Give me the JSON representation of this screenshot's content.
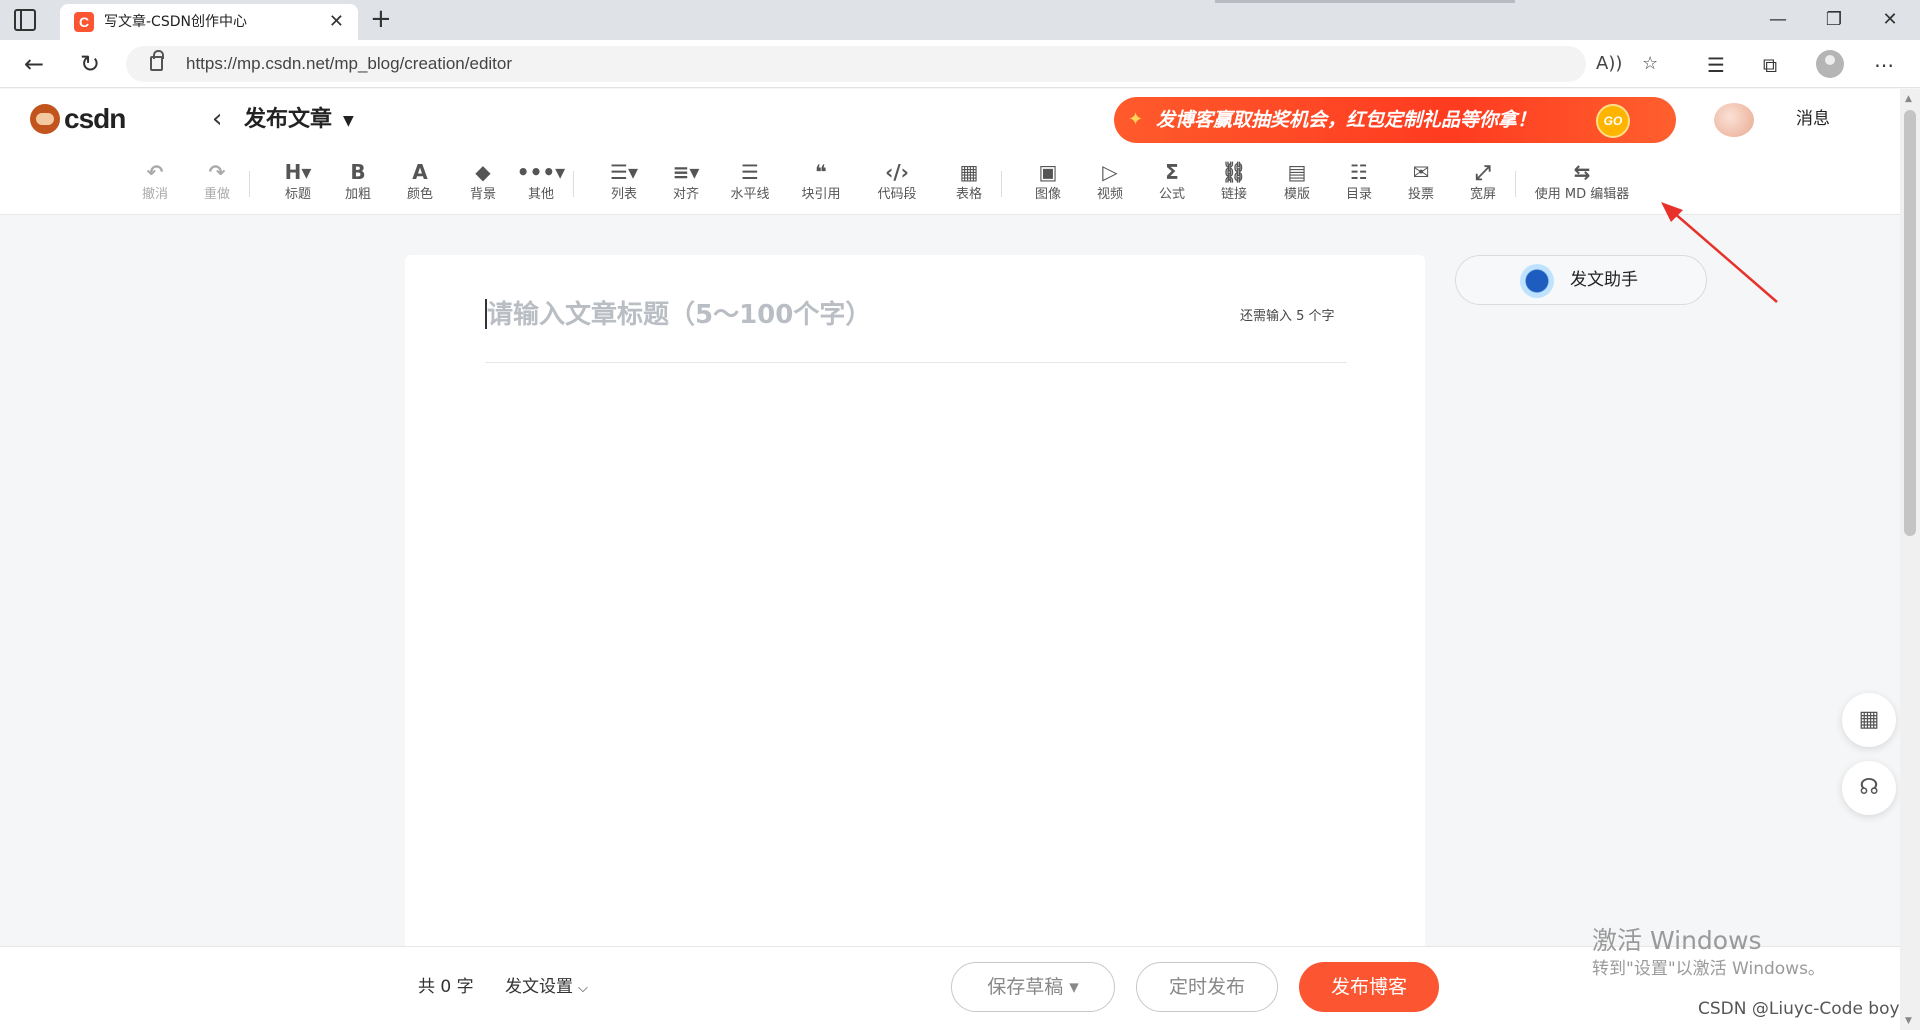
{
  "browser": {
    "tab_title": "写文章-CSDN创作中心",
    "tab_favicon": "C",
    "tab_close": "✕",
    "new_tab": "+",
    "url": "https://mp.csdn.net/mp_blog/creation/editor",
    "window_controls": {
      "minimize": "—",
      "restore": "❐",
      "close": "✕"
    },
    "nav": {
      "back": "←",
      "refresh": "↻"
    },
    "icons": [
      "read-aloud-icon",
      "add-favorite-icon",
      "favorites-icon",
      "collections-icon",
      "profile-icon",
      "more-icon"
    ]
  },
  "header": {
    "logo_text": "csdn",
    "back_chevron": "‹",
    "page_title": "发布文章",
    "promo_text": "发博客赢取抽奖机会，红包定制礼品等你拿！",
    "promo_go": "GO",
    "messages": "消息"
  },
  "toolbar": {
    "items": [
      {
        "icon": "↶",
        "label": "撤消",
        "name": "undo"
      },
      {
        "icon": "↷",
        "label": "重做",
        "name": "redo"
      },
      {
        "icon": "H▾",
        "label": "标题",
        "name": "heading"
      },
      {
        "icon": "B",
        "label": "加粗",
        "name": "bold"
      },
      {
        "icon": "A",
        "label": "颜色",
        "name": "color"
      },
      {
        "icon": "◆",
        "label": "背景",
        "name": "background"
      },
      {
        "icon": "•••▾",
        "label": "其他",
        "name": "other"
      },
      {
        "icon": "☰▾",
        "label": "列表",
        "name": "list"
      },
      {
        "icon": "≡▾",
        "label": "对齐",
        "name": "align"
      },
      {
        "icon": "☰",
        "label": "水平线",
        "name": "horizontal-rule"
      },
      {
        "icon": "❝",
        "label": "块引用",
        "name": "blockquote"
      },
      {
        "icon": "‹/›",
        "label": "代码段",
        "name": "code-block"
      },
      {
        "icon": "▦",
        "label": "表格",
        "name": "table"
      },
      {
        "icon": "▣",
        "label": "图像",
        "name": "image"
      },
      {
        "icon": "▷",
        "label": "视频",
        "name": "video"
      },
      {
        "icon": "Σ",
        "label": "公式",
        "name": "formula"
      },
      {
        "icon": "⛓",
        "label": "链接",
        "name": "link"
      },
      {
        "icon": "▤",
        "label": "模版",
        "name": "template"
      },
      {
        "icon": "☷",
        "label": "目录",
        "name": "toc"
      },
      {
        "icon": "✉",
        "label": "投票",
        "name": "vote"
      },
      {
        "icon": "⤢",
        "label": "宽屏",
        "name": "widescreen"
      },
      {
        "icon": "⇆",
        "label": "使用 MD 编辑器",
        "name": "md-editor"
      }
    ]
  },
  "editor": {
    "title_placeholder": "请输入文章标题（5～100个字）",
    "title_value": "",
    "remain_hint": "还需输入 5 个字"
  },
  "assistant": {
    "label": "发文助手"
  },
  "side_widgets": {
    "qr": "▦",
    "support": "☊"
  },
  "footer": {
    "word_count": "共 0 字",
    "post_settings": "发文设置",
    "post_settings_caret": "⌵",
    "save_draft": "保存草稿 ▾",
    "schedule": "定时发布",
    "publish": "发布博客"
  },
  "overlay": {
    "activate_title": "激活 Windows",
    "activate_sub": "转到\"设置\"以激活 Windows。",
    "credit": "CSDN @Liuyc-Code boy"
  },
  "colors": {
    "brand": "#fc5531",
    "arrow": "#e8312b"
  }
}
